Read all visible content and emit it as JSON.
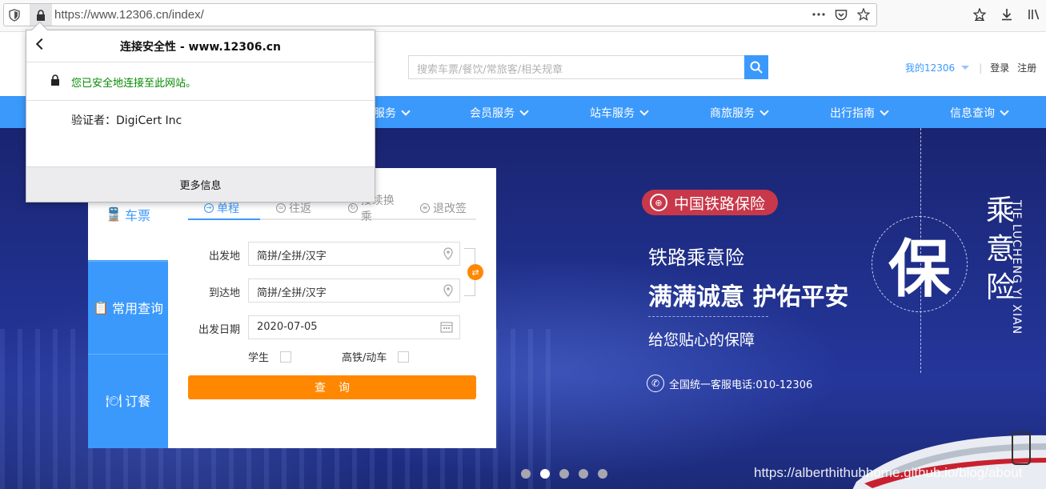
{
  "browser": {
    "url": "https://www.12306.cn/index/",
    "icons": [
      "shield-icon",
      "lock-icon",
      "more-icon",
      "pocket-icon",
      "star-icon",
      "bookmark-star-icon",
      "download-icon",
      "library-icon"
    ]
  },
  "header": {
    "search_placeholder": "搜索车票/餐饮/常旅客/相关规章",
    "my_account": "我的12306",
    "login": "登录",
    "register": "注册"
  },
  "nav": {
    "items": [
      {
        "label": "服务"
      },
      {
        "label": "会员服务"
      },
      {
        "label": "站车服务"
      },
      {
        "label": "商旅服务"
      },
      {
        "label": "出行指南"
      },
      {
        "label": "信息查询"
      }
    ]
  },
  "booking": {
    "side_tabs": [
      {
        "label": "车票"
      },
      {
        "label": "常用查询"
      },
      {
        "label": "订餐"
      }
    ],
    "trip_tabs": [
      {
        "label": "单程"
      },
      {
        "label": "往返"
      },
      {
        "label": "接续换乘"
      },
      {
        "label": "退改签"
      }
    ],
    "from_label": "出发地",
    "from_value": "简拼/全拼/汉字",
    "to_label": "到达地",
    "to_value": "简拼/全拼/汉字",
    "date_label": "出发日期",
    "date_value": "2020-07-05",
    "student_label": "学生",
    "highspeed_label": "高铁/动车",
    "query_button": "查询"
  },
  "banner": {
    "badge": "中国铁路保险",
    "line1": "铁路乘意险",
    "line2": "满满诚意 护佑平安",
    "line3": "给您贴心的保障",
    "phone": "全国统一客服电话:010-12306",
    "circle_char": "保",
    "vertical_cn": "乘意险",
    "vertical_en": "TIE LUCHENG YI XIAN",
    "carousel_count": 5,
    "carousel_active": 2,
    "watermark": "https://alberthithubhome.github.io/blog/about"
  },
  "popup": {
    "title": "连接安全性 - www.12306.cn",
    "secure_text": "您已安全地连接至此网站。",
    "verifier": "验证者：DigiCert Inc",
    "more_info": "更多信息"
  },
  "colors": {
    "brand_blue": "#3b99fc",
    "orange": "#ff8800",
    "insurance_red": "#c8384a",
    "secure_green": "#058b00"
  }
}
